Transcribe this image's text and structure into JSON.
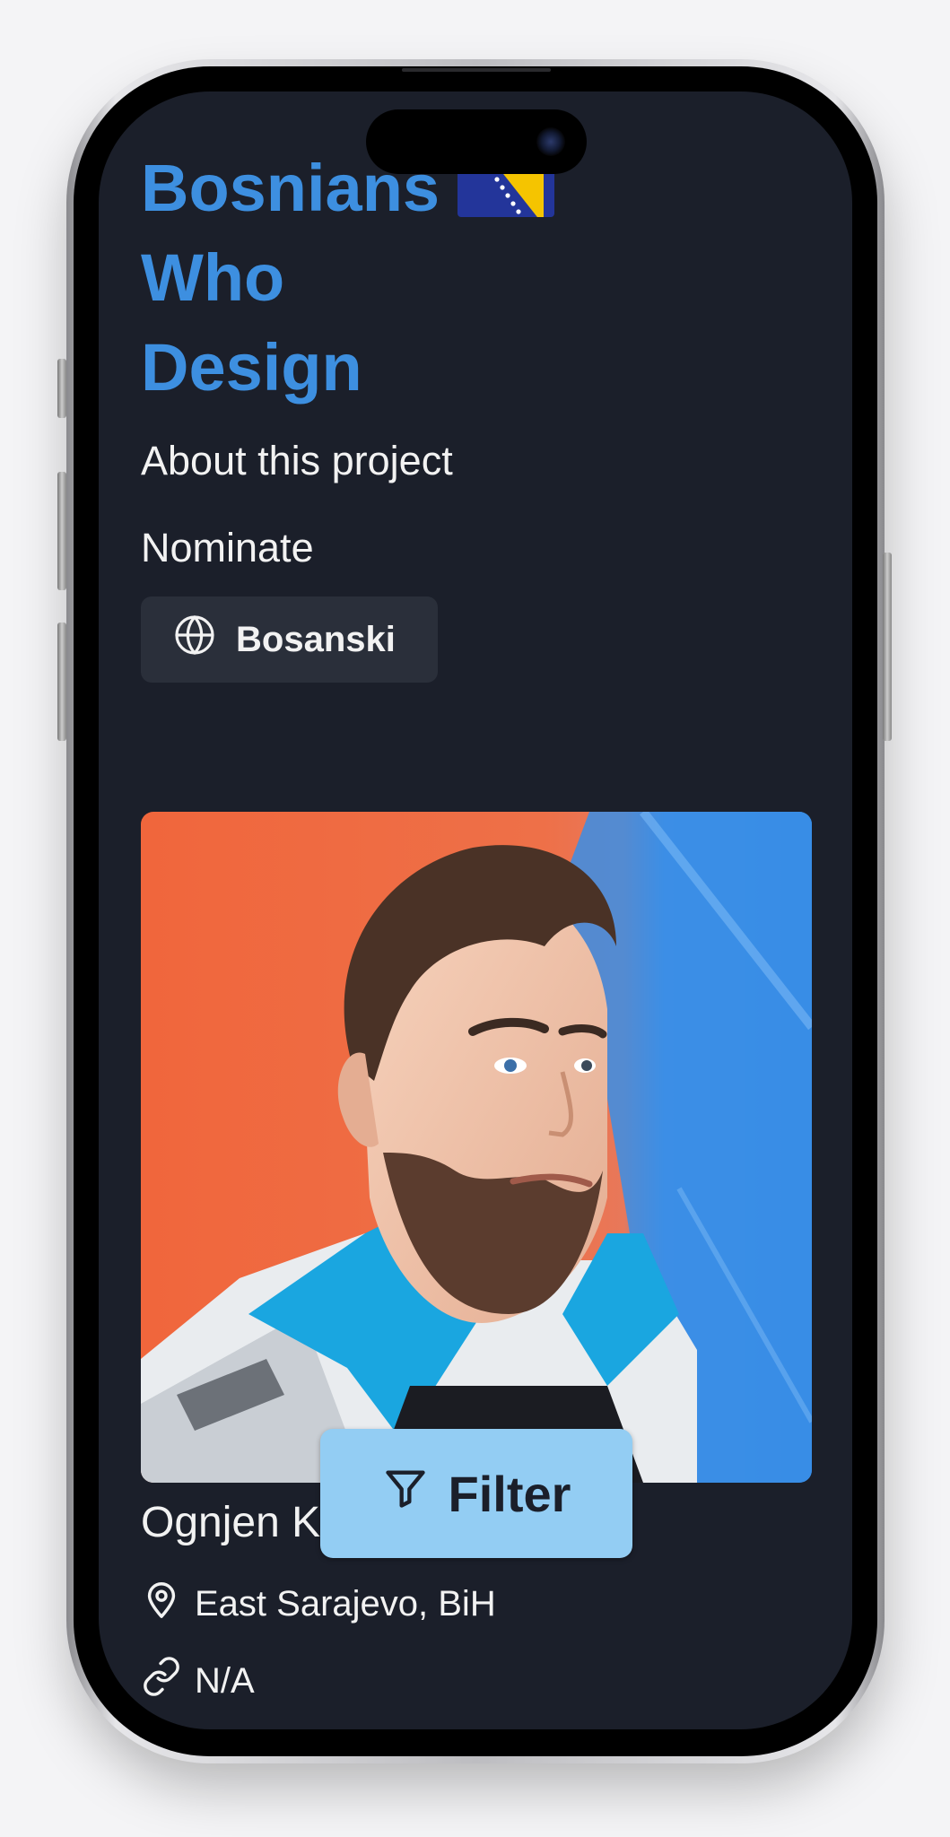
{
  "site": {
    "title_lines": [
      "Bosnians",
      "Who",
      "Design"
    ],
    "flag_icon": "bosnia-flag-icon"
  },
  "nav": {
    "about": "About this project",
    "nominate": "Nominate"
  },
  "language_button": {
    "icon": "globe-icon",
    "label": "Bosanski"
  },
  "designer": {
    "name": "Ognjen K",
    "location": "East Sarajevo, BiH",
    "website": "N/A",
    "location_icon": "map-pin-icon",
    "link_icon": "link-icon"
  },
  "filter_button": {
    "icon": "filter-icon",
    "label": "Filter"
  },
  "colors": {
    "background": "#1b1f2a",
    "title": "#3d8fe0",
    "filter_button": "#93cdf3",
    "language_button": "#2a2f3a"
  }
}
